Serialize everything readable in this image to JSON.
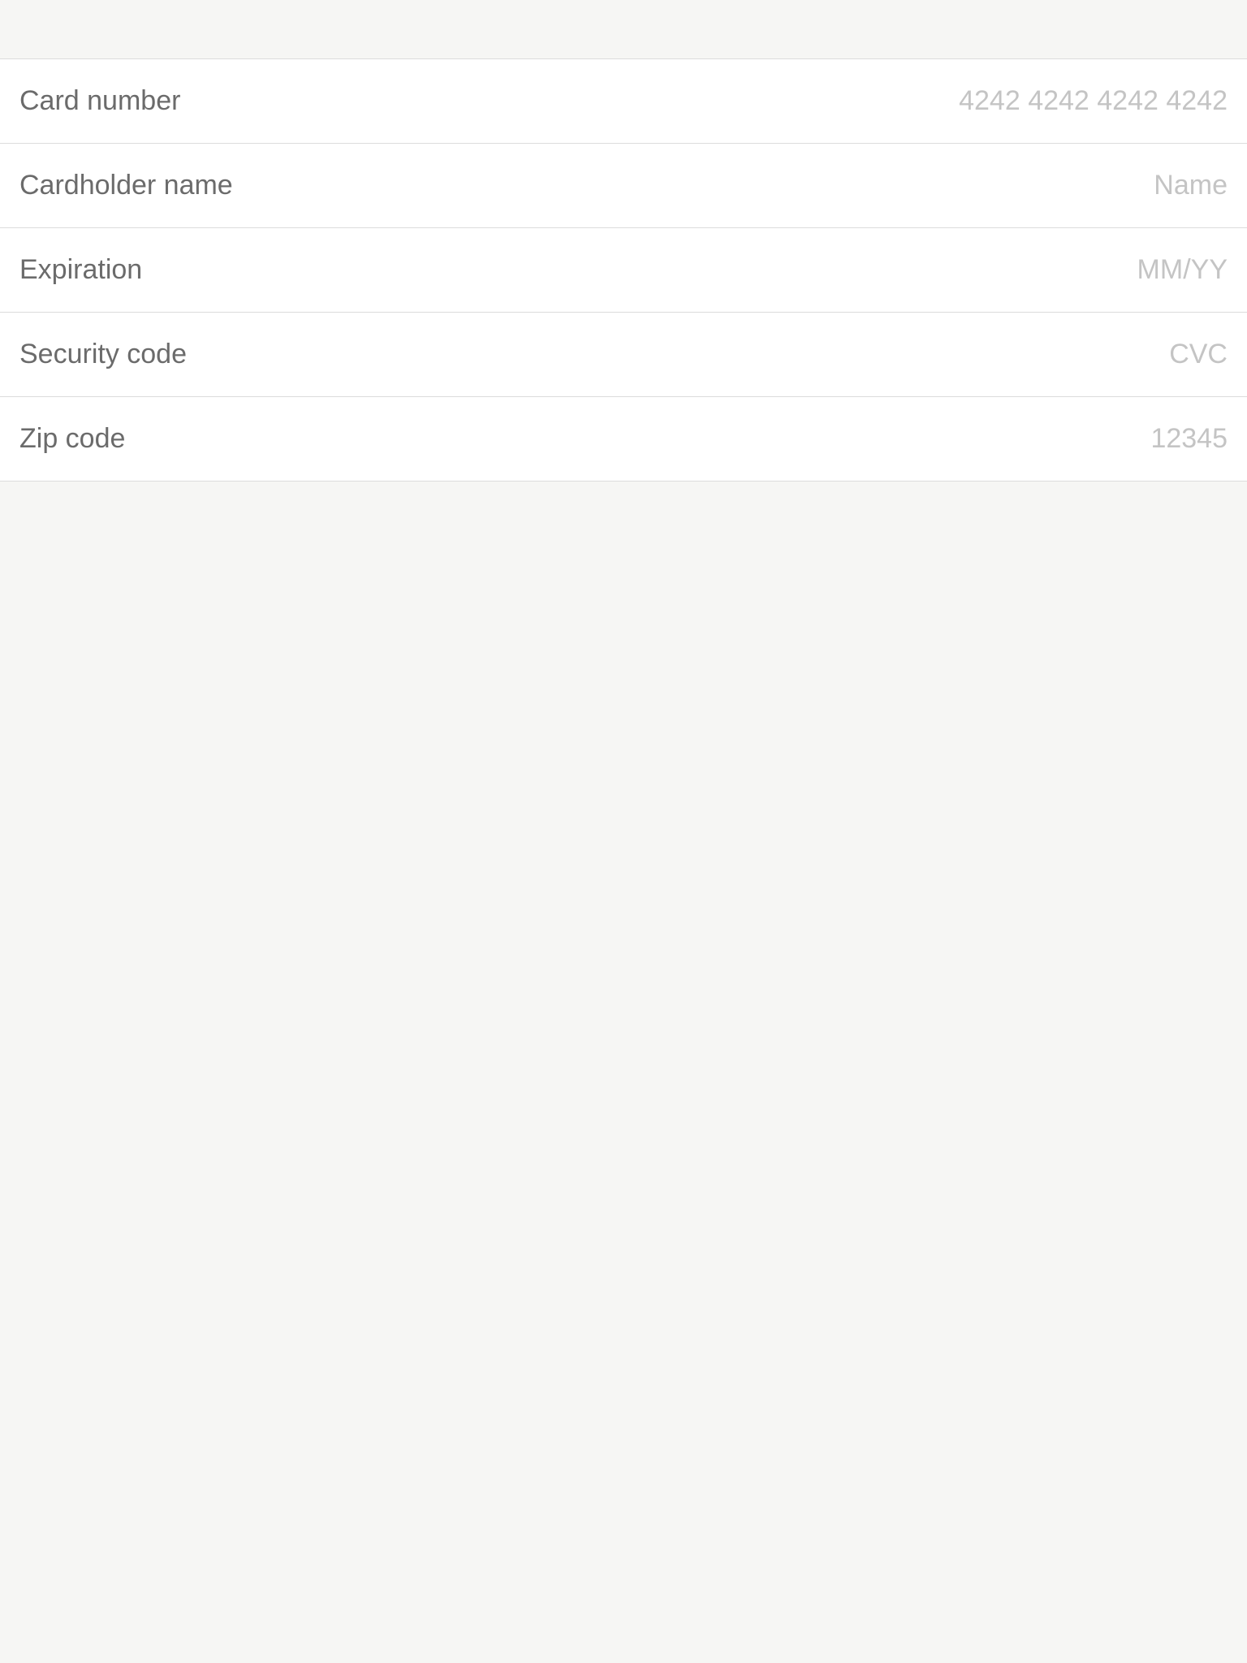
{
  "form": {
    "rows": [
      {
        "label": "Card number",
        "value": "",
        "placeholder": "4242 4242 4242 4242"
      },
      {
        "label": "Cardholder name",
        "value": "",
        "placeholder": "Name"
      },
      {
        "label": "Expiration",
        "value": "",
        "placeholder": "MM/YY"
      },
      {
        "label": "Security code",
        "value": "",
        "placeholder": "CVC"
      },
      {
        "label": "Zip code",
        "value": "",
        "placeholder": "12345"
      }
    ]
  },
  "colors": {
    "background": "#f6f6f4",
    "row_background": "#ffffff",
    "label_text": "#6b6b6b",
    "placeholder_text": "#c4c4c4",
    "divider": "#dcdcdc"
  }
}
